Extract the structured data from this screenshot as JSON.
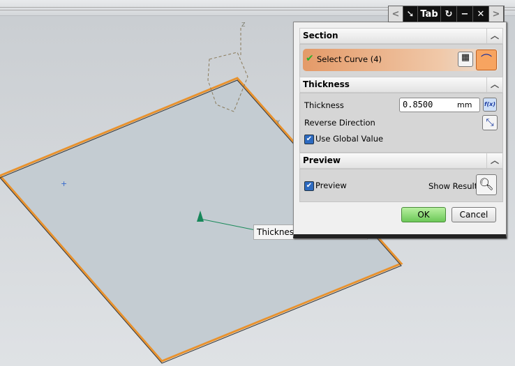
{
  "toolbar": {
    "tab_label": "Tab"
  },
  "section": {
    "title": "Section",
    "select_curve": "Select Curve (4)"
  },
  "thickness": {
    "title": "Thickness",
    "label": "Thickness",
    "value": "0.8500",
    "unit": "mm",
    "fx": "f(x)",
    "reverse_direction": "Reverse Direction",
    "use_global_value": "Use Global Value",
    "use_global_checked": true
  },
  "preview": {
    "title": "Preview",
    "preview_label": "Preview",
    "preview_checked": true,
    "show_result": "Show Result"
  },
  "buttons": {
    "ok": "OK",
    "cancel": "Cancel"
  },
  "viewport": {
    "thickness_callout": "Thickness",
    "axis_z": "Z",
    "axis_y": "Y"
  },
  "colors": {
    "accent_orange": "#e8a070",
    "ok_green": "#7ed26a",
    "edge_orange": "#e8922e"
  }
}
